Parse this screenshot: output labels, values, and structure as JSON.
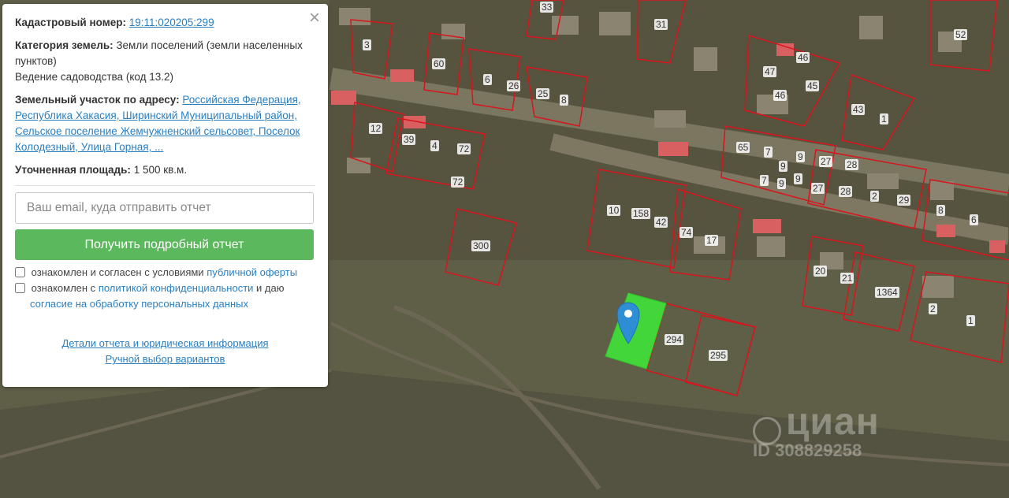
{
  "panel": {
    "close_label": "×",
    "cadastral": {
      "label": "Кадастровый номер:",
      "value": "19:11:020205:299"
    },
    "category": {
      "label": "Категория земель:",
      "value": "Земли поселений (земли населенных пунктов)",
      "use": "Ведение садоводства (код 13.2)"
    },
    "address": {
      "label": "Земельный участок по адресу:",
      "value": "Российская Федерация, Республика Хакасия, Ширинский Муниципальный район, Сельское поселение Жемчужненский сельсовет, Поселок Колодезный, Улица Горная, ..."
    },
    "area": {
      "label": "Уточненная площадь:",
      "value": "1 500 кв.м."
    },
    "email_placeholder": "Ваш email, куда отправить отчет",
    "submit_label": "Получить подробный отчет",
    "consent1": {
      "text": "ознакомлен и согласен с условиями",
      "link": "публичной оферты"
    },
    "consent2": {
      "text1": "ознакомлен с",
      "link1": "политикой конфиденциальности",
      "text2": "и даю",
      "link2": "согласие на обработку персональных данных"
    },
    "link_details": "Детали отчета и юридическая информация",
    "link_manual": "Ручной выбор вариантов"
  },
  "map": {
    "boundary_color": "#d9141c",
    "selected_color": "#3fe33a",
    "parcel_labels": [
      "3",
      "60",
      "6",
      "26",
      "25",
      "8",
      "33",
      "31",
      "52",
      "47",
      "46",
      "46",
      "45",
      "43",
      "1",
      "12",
      "39",
      "4",
      "72",
      "72",
      "65",
      "7",
      "9",
      "9",
      "7",
      "9",
      "9",
      "27",
      "27",
      "28",
      "28",
      "2",
      "29",
      "8",
      "6",
      "10",
      "158",
      "42",
      "74",
      "17",
      "300",
      "20",
      "21",
      "1364",
      "2",
      "1",
      "294",
      "295"
    ]
  },
  "watermark": {
    "brand": "циан",
    "id": "ID 308829258"
  }
}
